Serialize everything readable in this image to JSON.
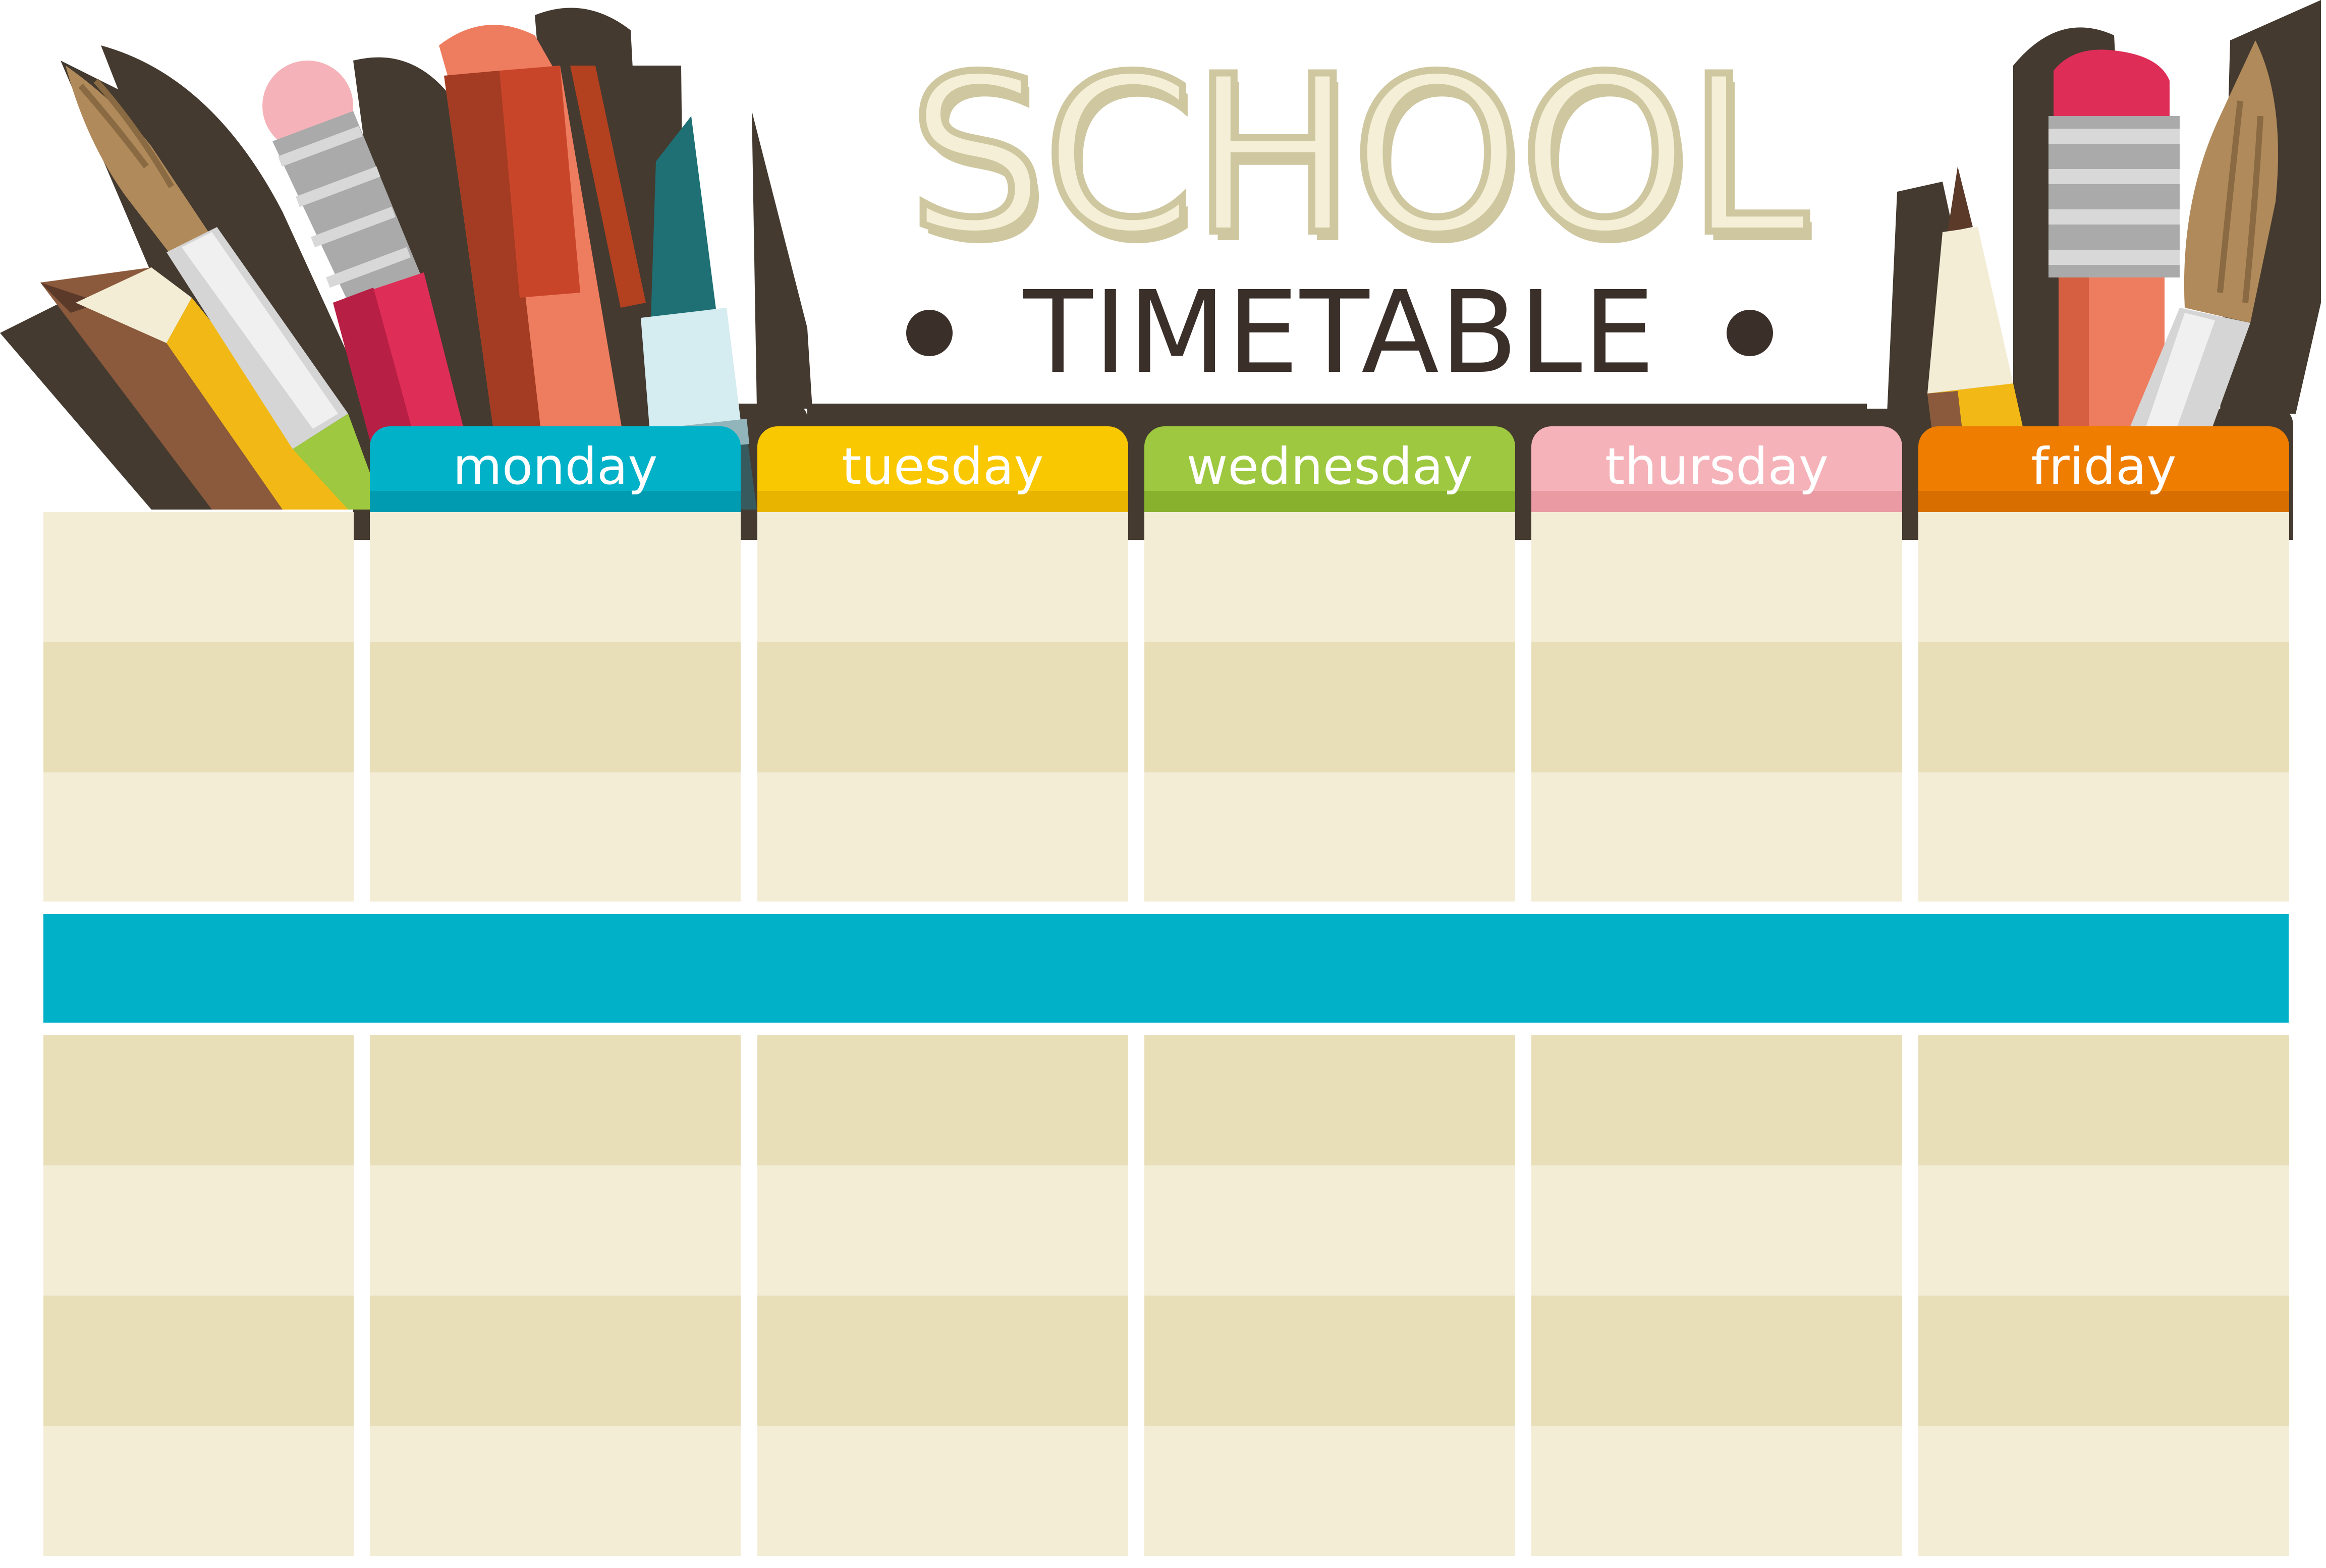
{
  "header": {
    "title": "SCHOOL",
    "subtitle": "TIMETABLE"
  },
  "days": [
    {
      "label": "monday",
      "color": "#00b1c8",
      "shade": "#009bb0"
    },
    {
      "label": "tuesday",
      "color": "#f9c800",
      "shade": "#e8b400"
    },
    {
      "label": "wednesday",
      "color": "#9dc83f",
      "shade": "#88b22e"
    },
    {
      "label": "thursday",
      "color": "#f5b3b9",
      "shade": "#e99aa2"
    },
    {
      "label": "friday",
      "color": "#ee7d00",
      "shade": "#d86e00"
    }
  ],
  "grid": {
    "columns": 6,
    "rows_before_break": 3,
    "rows_after_break": 4,
    "light_color": "#f3edd6",
    "dark_color": "#e8dfb9",
    "break_bar_color": "#00b1c8"
  },
  "icons": [
    "paintbrush-icon",
    "pencil-icon",
    "pen-icon",
    "marker-icon",
    "eraser-pencil-icon"
  ]
}
